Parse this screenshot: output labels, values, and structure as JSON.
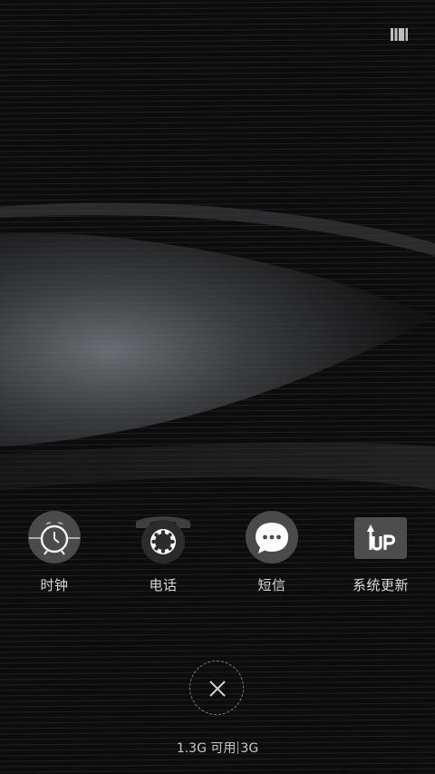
{
  "status_icon": "recent-tasks-grid-icon",
  "apps": [
    {
      "label": "时钟",
      "icon": "alarm-clock-icon"
    },
    {
      "label": "电话",
      "icon": "rotary-phone-icon"
    },
    {
      "label": "短信",
      "icon": "message-bubble-icon"
    },
    {
      "label": "系统更新",
      "icon": "system-update-icon"
    }
  ],
  "close_icon": "close-icon",
  "memory": {
    "available": "1.3G 可用",
    "total": "3G"
  },
  "colors": {
    "background": "#0b0b0c",
    "label": "#d8d8d8",
    "icon_fill": "#4a4a4a"
  }
}
